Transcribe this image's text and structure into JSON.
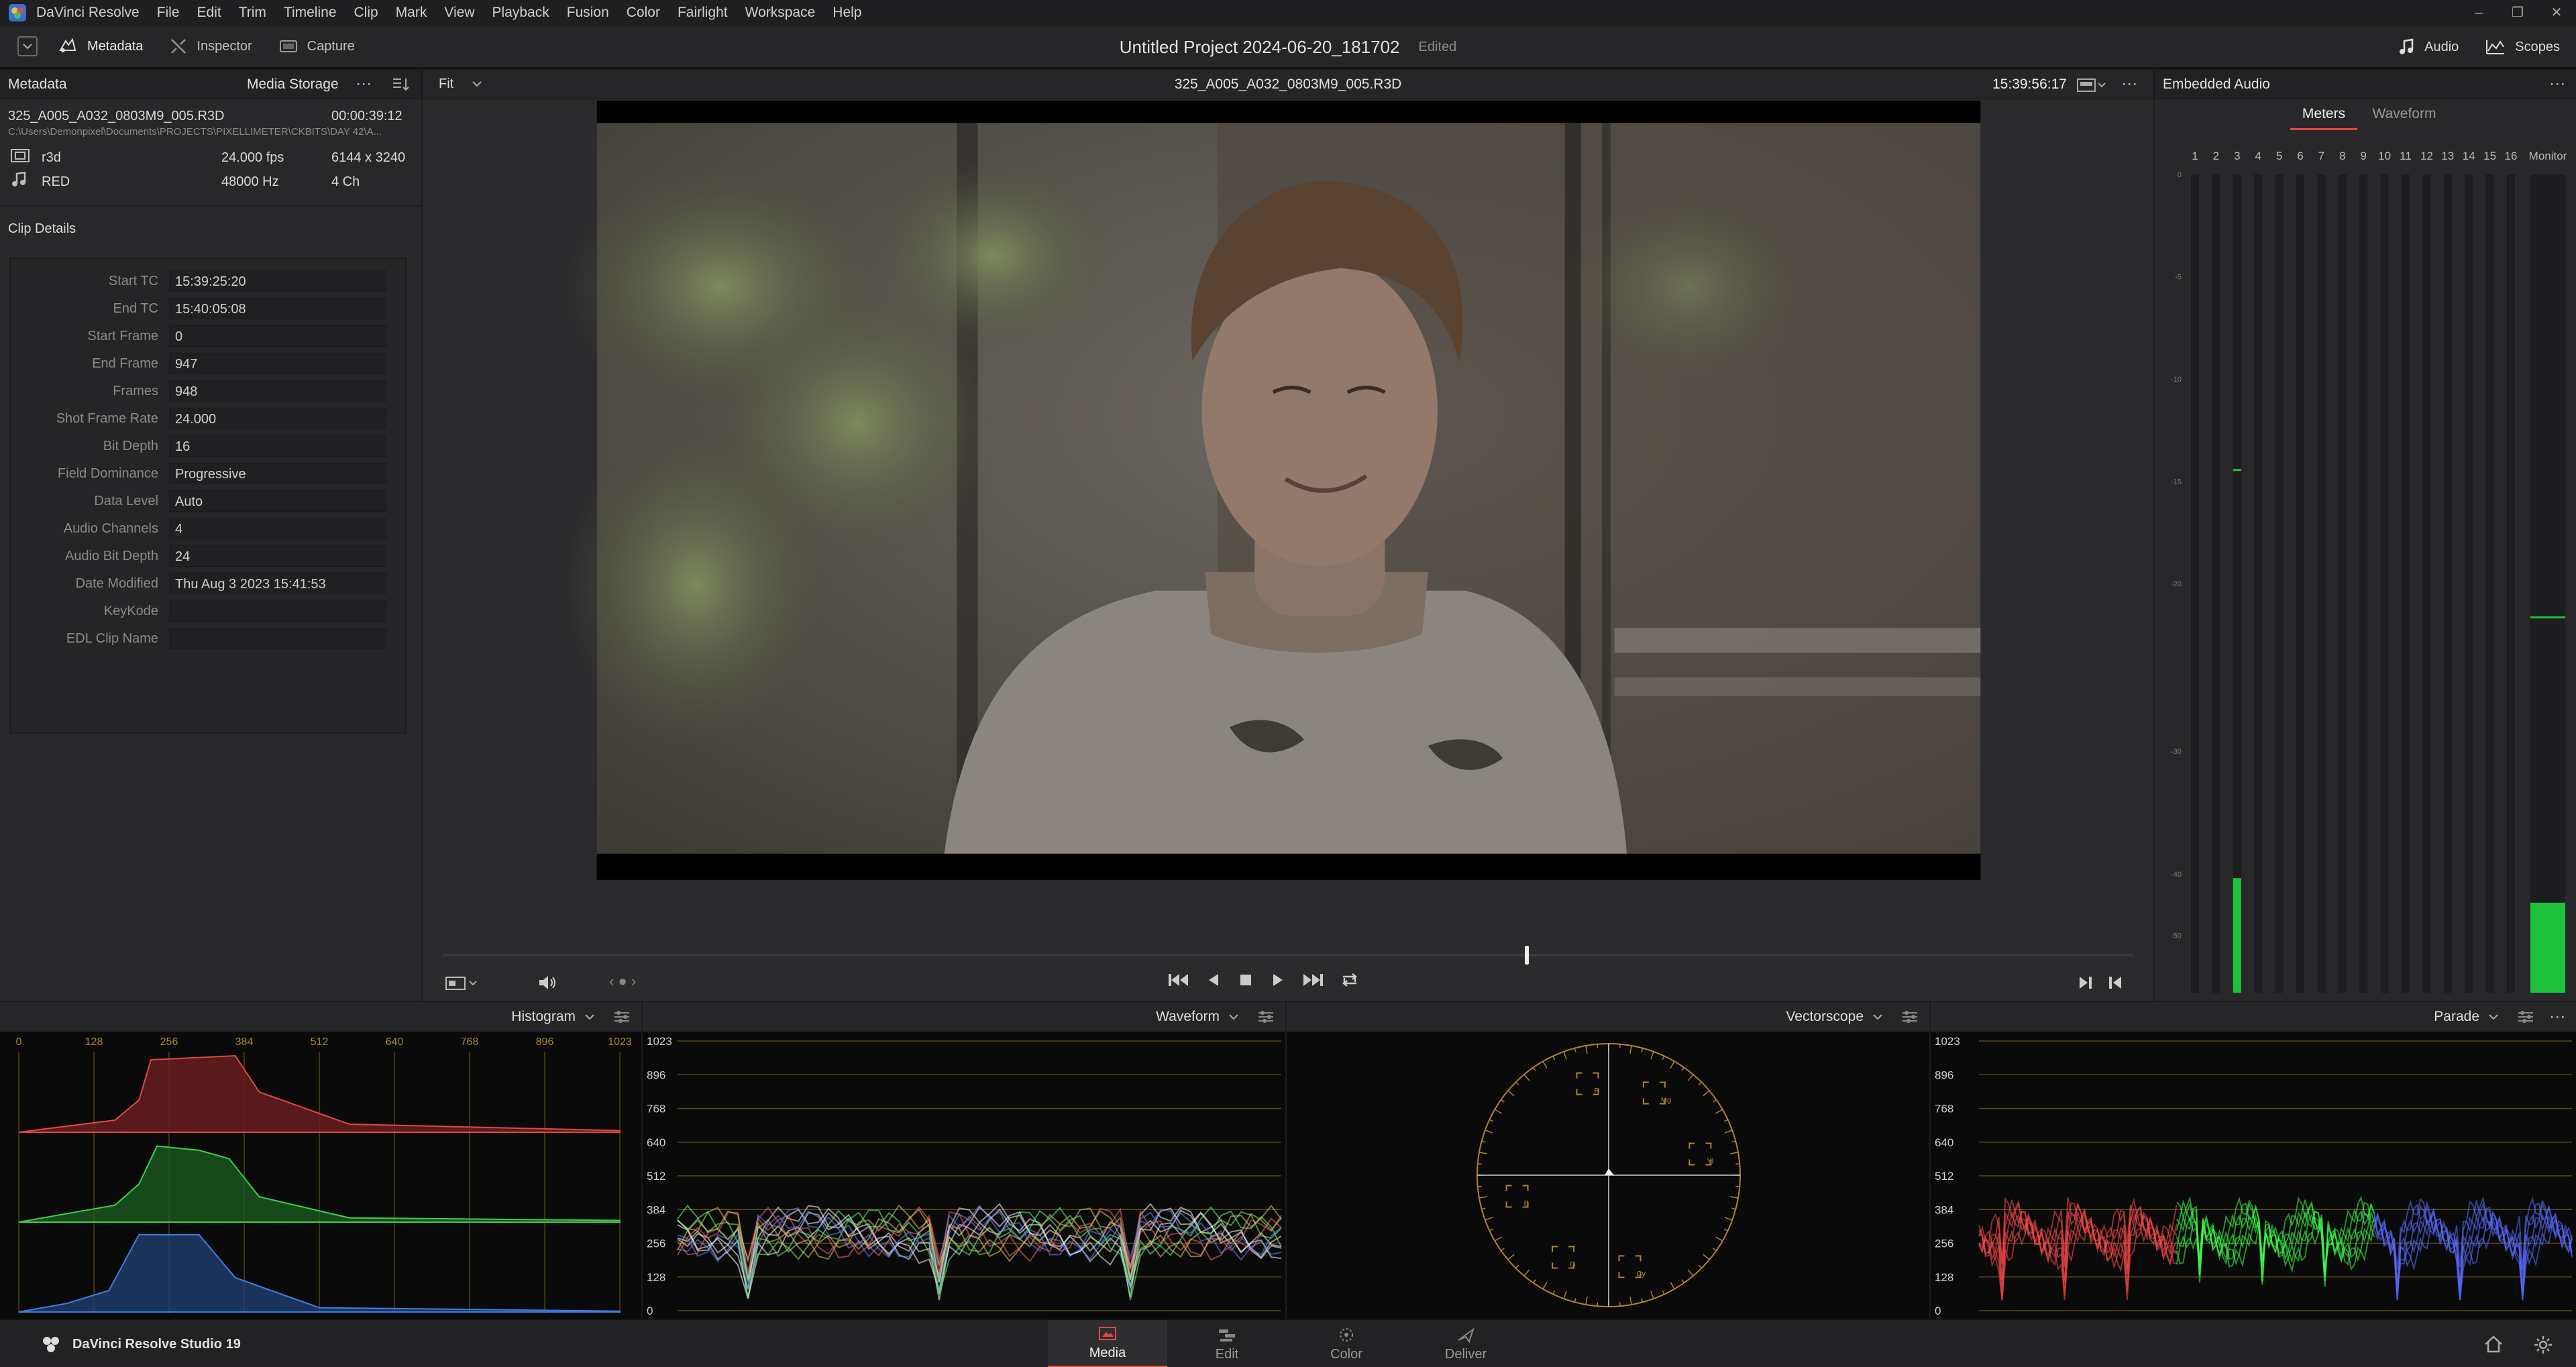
{
  "menubar": {
    "app_name": "DaVinci Resolve",
    "items": [
      "File",
      "Edit",
      "Trim",
      "Timeline",
      "Clip",
      "Mark",
      "View",
      "Playback",
      "Fusion",
      "Color",
      "Fairlight",
      "Workspace",
      "Help"
    ]
  },
  "toolbar": {
    "metadata_label": "Metadata",
    "inspector_label": "Inspector",
    "capture_label": "Capture",
    "project_title": "Untitled Project 2024-06-20_181702",
    "edited_label": "Edited",
    "audio_label": "Audio",
    "scopes_label": "Scopes"
  },
  "metadata_panel": {
    "title": "Metadata",
    "storage_label": "Media Storage",
    "clip_name": "325_A005_A032_0803M9_005.R3D",
    "duration": "00:00:39:12",
    "path": "C:\\Users\\Demonpixel\\Documents\\PROJECTS\\PIXELLIMETER\\CKBITS\\DAY 42\\A...",
    "format": "r3d",
    "fps": "24.000 fps",
    "resolution": "6144 x 3240",
    "codec": "RED",
    "sample_rate": "48000 Hz",
    "channels": "4 Ch",
    "section_title": "Clip Details",
    "details": [
      {
        "key": "Start TC",
        "value": "15:39:25:20"
      },
      {
        "key": "End TC",
        "value": "15:40:05:08"
      },
      {
        "key": "Start Frame",
        "value": "0"
      },
      {
        "key": "End Frame",
        "value": "947"
      },
      {
        "key": "Frames",
        "value": "948"
      },
      {
        "key": "Shot Frame Rate",
        "value": "24.000"
      },
      {
        "key": "Bit Depth",
        "value": "16"
      },
      {
        "key": "Field Dominance",
        "value": "Progressive"
      },
      {
        "key": "Data Level",
        "value": "Auto"
      },
      {
        "key": "Audio Channels",
        "value": "4"
      },
      {
        "key": "Audio Bit Depth",
        "value": "24"
      },
      {
        "key": "Date Modified",
        "value": "Thu Aug 3 2023 15:41:53"
      },
      {
        "key": "KeyKode",
        "value": ""
      },
      {
        "key": "EDL Clip Name",
        "value": ""
      }
    ]
  },
  "viewer": {
    "zoom": "Fit",
    "clip_name": "325_A005_A032_0803M9_005.R3D",
    "timecode": "15:39:56:17",
    "playhead_fraction": 0.64
  },
  "audio_panel": {
    "title": "Embedded Audio",
    "tab_meters": "Meters",
    "tab_waveform": "Waveform",
    "channels": [
      "1",
      "2",
      "3",
      "4",
      "5",
      "6",
      "7",
      "8",
      "9",
      "10",
      "11",
      "12",
      "13",
      "14",
      "15",
      "16"
    ],
    "monitor_label": "Monitor",
    "scale": [
      "0",
      "-5",
      "-10",
      "-15",
      "-20",
      "-30",
      "-40",
      "-50"
    ],
    "channel3_level": 0.14,
    "channel3_peak": 0.64,
    "monitor_level": 0.11,
    "monitor_peak": 0.46
  },
  "scopes": {
    "histogram_title": "Histogram",
    "histogram_ticks": [
      "0",
      "128",
      "256",
      "384",
      "512",
      "640",
      "768",
      "896",
      "1023"
    ],
    "waveform_title": "Waveform",
    "vectorscope_title": "Vectorscope",
    "parade_title": "Parade",
    "level_ticks": [
      "1023",
      "896",
      "768",
      "640",
      "512",
      "384",
      "256",
      "128",
      "0"
    ],
    "vector_targets": [
      "R",
      "Mg",
      "B",
      "Cy",
      "G",
      "Yl"
    ]
  },
  "bottombar": {
    "brand": "DaVinci Resolve Studio 19",
    "tabs": [
      "Media",
      "Edit",
      "Color",
      "Deliver"
    ],
    "active_tab": "Media"
  },
  "colors": {
    "accent_red": "#e04646",
    "meter_green": "#1ec23a",
    "scope_gold": "#a8862e"
  }
}
